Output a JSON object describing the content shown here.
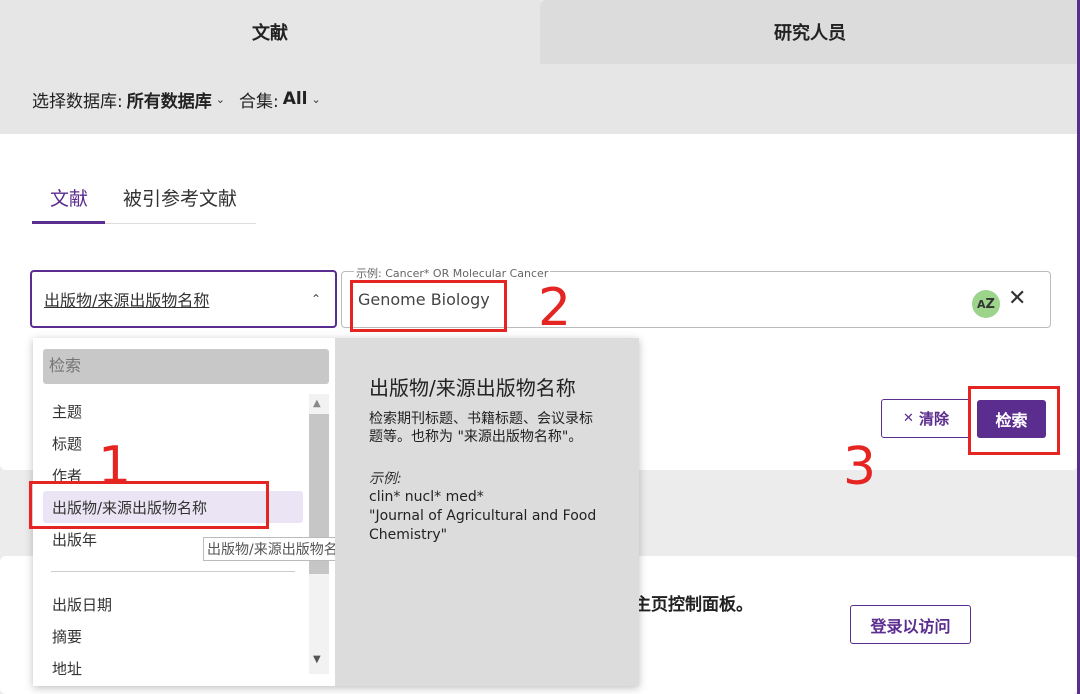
{
  "top_tabs": {
    "documents": "文献",
    "researchers": "研究人员"
  },
  "db_bar": {
    "db_label": "选择数据库:",
    "db_value": "所有数据库",
    "collection_label": "合集:",
    "collection_value": "All"
  },
  "sub_tabs": {
    "documents": "文献",
    "cited_refs": "被引参考文献"
  },
  "field_select": {
    "value": "出版物/来源出版物名称"
  },
  "search": {
    "placeholder": "示例: Cancer* OR Molecular Cancer",
    "value": "Genome Biology"
  },
  "buttons": {
    "clear": "清除",
    "search": "检索",
    "login": "登录以访问"
  },
  "dashboard_text": "主页控制面板。",
  "dropdown": {
    "search_placeholder": "检索",
    "items": [
      "主题",
      "标题",
      "作者",
      "出版物/来源出版物名称",
      "出版年",
      "出版日期",
      "摘要",
      "地址"
    ],
    "tooltip": "出版物/来源出版物名称"
  },
  "help": {
    "title": "出版物/来源出版物名称",
    "desc": "检索期刊标题、书籍标题、会议录标题等。也称为 \"来源出版物名称\"。",
    "example_label": "示例:",
    "examples": [
      "clin* nucl* med*",
      "\"Journal of Agricultural and Food Chemistry\""
    ]
  },
  "annotations": [
    "1",
    "2",
    "3"
  ],
  "colors": {
    "accent": "#5b2d8e",
    "annotation": "#e52521"
  }
}
